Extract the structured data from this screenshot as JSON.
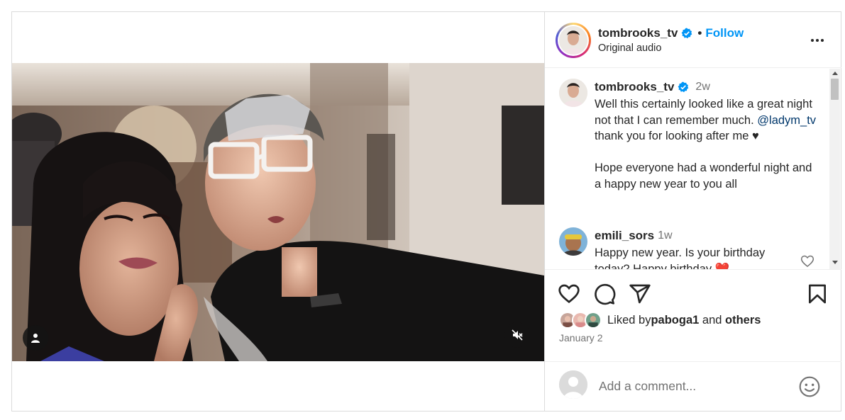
{
  "post": {
    "username": "tombrooks_tv",
    "follow_label": "Follow",
    "dot": "•",
    "audio_label": "Original audio"
  },
  "caption": {
    "username": "tombrooks_tv",
    "time": "2w",
    "line1": "Well this certainly looked like a great night not that I can remember much.",
    "mention": "@ladym_tv",
    "line2": " thank you for looking after me ♥",
    "line3": "Hope everyone had a wonderful night and a happy new year to you all"
  },
  "comments": [
    {
      "username": "emili_sors",
      "time": "1w",
      "text": "Happy new year. Is your birthday today? Happy birthday ❤️"
    }
  ],
  "likes": {
    "prefix": "Liked by ",
    "user": "paboga1",
    "middle": " and ",
    "others": "others"
  },
  "date": "January 2",
  "add_comment": {
    "placeholder": "Add a comment..."
  },
  "icons": {
    "heart": "heart-icon",
    "comment": "comment-icon",
    "share": "share-icon",
    "save": "bookmark-icon",
    "more": "more-options-icon",
    "tag": "user-tag-icon",
    "mute": "mute-icon",
    "emoji": "emoji-icon",
    "verified": "verified-icon"
  },
  "colors": {
    "follow": "#0095f6",
    "mention": "#00376b",
    "verified": "#0095f6",
    "muted_text": "#737373"
  }
}
